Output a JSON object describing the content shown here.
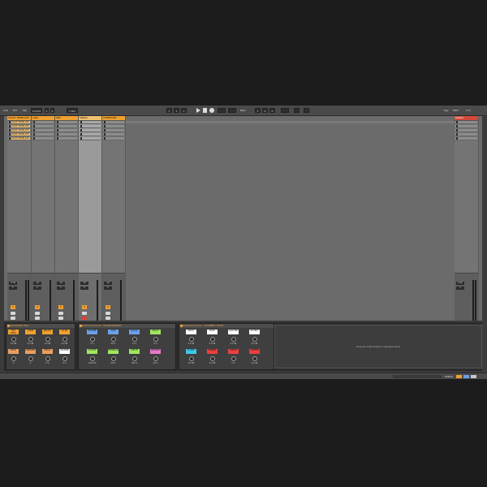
{
  "menu": {
    "items": [
      "Link",
      "Ext",
      "Tap"
    ],
    "tempo": "120.00",
    "sig_num": "4",
    "sig_den": "4",
    "quant": "1 Bar"
  },
  "transport": {
    "pos_a": "1",
    "pos_b": "1",
    "pos_c": "1",
    "loop_label": "New",
    "right_a": "1",
    "right_b": "0",
    "right_c": "0",
    "key": "Key",
    "midi": "MIDI",
    "cpu": "4 %"
  },
  "tracks": [
    {
      "name": "VOICE TEMPLATE",
      "color": "#f0a030",
      "clips": [
        "VOICE TEMPLATE",
        "VOICE TEMPLATE",
        "VOICE TEMPLATE",
        "VOICE TEMPLATE",
        "VOICE TEMPLATE"
      ],
      "vol": "-0.00",
      "pan": "C",
      "num": "1"
    },
    {
      "name": "LOW",
      "color": "#f0a030",
      "clips": [
        "",
        "",
        "",
        "",
        ""
      ],
      "vol": "-inf",
      "pan": "C",
      "num": "2"
    },
    {
      "name": "MID",
      "color": "#f0a030",
      "clips": [
        "",
        "",
        "",
        "",
        ""
      ],
      "vol": "-inf",
      "pan": "C",
      "num": "3"
    },
    {
      "name": "SPEAK",
      "color": "#f0a030",
      "clips": [
        "",
        "",
        "",
        "",
        ""
      ],
      "vol": "-inf",
      "pan": "C",
      "num": "4"
    },
    {
      "name": "SYMPHONY",
      "color": "#f0a030",
      "clips": [
        "",
        "",
        "",
        "",
        ""
      ],
      "vol": "-inf",
      "pan": "C",
      "num": "5"
    }
  ],
  "master": {
    "name": "Master",
    "color": "#d44a3a",
    "vol": "0.00",
    "pan": "C"
  },
  "devices": {
    "rack1": {
      "title": "ADVANCED MIC",
      "macros": [
        {
          "label": "MIX LEVEL",
          "color": "#f0a030",
          "val": "0.0 dB"
        },
        {
          "label": "COMP",
          "color": "#f0a030",
          "val": "0.0 dB"
        },
        {
          "label": "PRE EQ",
          "color": "#f0a030",
          "val": "0.0 dB"
        },
        {
          "label": "FX EQ",
          "color": "#f0a030",
          "val": "0.0 dB"
        },
        {
          "label": "PITCH",
          "color": "#e8a060",
          "val": "0"
        },
        {
          "label": "FORMANT",
          "color": "#e8a060",
          "val": "0"
        },
        {
          "label": "DELAY",
          "color": "#e8a060",
          "val": "0 %"
        },
        {
          "label": "REVERB",
          "color": "#ffffff",
          "val": "0 %"
        }
      ]
    },
    "rack2": {
      "title": "Overlord Sound - ENVIRONMENT",
      "macros": [
        {
          "label": "REVERB",
          "color": "#6aa0e8",
          "val": "0 %"
        },
        {
          "label": "SIZE",
          "color": "#6aa0e8",
          "val": "50 %"
        },
        {
          "label": "DECAY",
          "color": "#6aa0e8",
          "val": "2.0 s"
        },
        {
          "label": "DELAY",
          "color": "#a0e860",
          "val": "0 %"
        },
        {
          "label": "CUTOFF",
          "color": "#a0e860",
          "val": "1.00 kHz"
        },
        {
          "label": "FEEDBACK",
          "color": "#a0e860",
          "val": "50 %"
        },
        {
          "label": "WIDTH",
          "color": "#a0e860",
          "val": "100 %"
        },
        {
          "label": "DRY/WET",
          "color": "#e878c8",
          "val": "50 %"
        }
      ]
    },
    "rack3": {
      "title": "Overlord Sound - CHANNEL STRIP",
      "macros": [
        {
          "label": "INPUT",
          "color": "#ffffff",
          "val": "0.0 dB"
        },
        {
          "label": "BASS",
          "color": "#ffffff",
          "val": "0.0 dB"
        },
        {
          "label": "LOW MID",
          "color": "#ffffff",
          "val": "0.0 dB"
        },
        {
          "label": "OUTPUT",
          "color": "#ffffff",
          "val": "0.0 dB"
        },
        {
          "label": "HI MID",
          "color": "#40c8e8",
          "val": "0.0 dB"
        },
        {
          "label": "TREBLE",
          "color": "#e84040",
          "val": "0.0 dB"
        },
        {
          "label": "DRIVE",
          "color": "#e84040",
          "val": "0 %"
        },
        {
          "label": "LIMITER",
          "color": "#e84040",
          "val": "0.0 dB"
        }
      ]
    }
  },
  "drop_text": "Drop an Instrument or Sample Here",
  "status": {
    "right_label": "SPEAK"
  }
}
